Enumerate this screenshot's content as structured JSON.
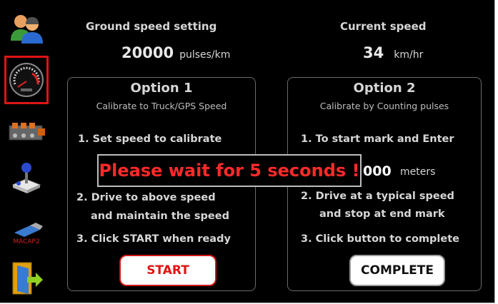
{
  "header": {
    "ground_label": "Ground speed setting",
    "ground_value": "20000",
    "ground_unit": "pulses/km",
    "current_label": "Current speed",
    "current_value": "34",
    "current_unit": "km/hr"
  },
  "sidebar": {
    "items": [
      {
        "icon": "users-icon"
      },
      {
        "icon": "speedometer-icon",
        "active": true
      },
      {
        "icon": "hydraulic-valve-icon"
      },
      {
        "icon": "joystick-icon"
      },
      {
        "icon": "usb-drive-icon",
        "label": "MACAP2"
      },
      {
        "icon": "exit-door-icon"
      }
    ]
  },
  "option1": {
    "title": "Option 1",
    "subtitle": "Calibrate to Truck/GPS Speed",
    "step1": "1. Set speed to calibrate",
    "step2a": "2. Drive to above speed",
    "step2b": "and maintain the speed",
    "step3": "3. Click START when ready",
    "button": "START"
  },
  "option2": {
    "title": "Option 2",
    "subtitle": "Calibrate by Counting pulses",
    "step1": "1. To start mark and Enter",
    "distance_value": "000",
    "distance_unit": "meters",
    "step2a": "2. Drive at a typical speed",
    "step2b": "and stop at end mark",
    "step3": "3. Click button to complete",
    "button": "COMPLETE"
  },
  "overlay": {
    "message": "Please wait for 5 seconds !"
  },
  "colors": {
    "background": "#000000",
    "active_border": "#e01414",
    "warning_text": "#ff2a2a",
    "start_text": "#e01414"
  }
}
